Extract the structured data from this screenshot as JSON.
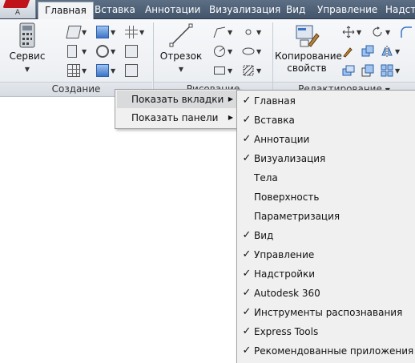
{
  "app_button": {
    "letter": "A"
  },
  "tabs": [
    {
      "label": "Главная",
      "active": true
    },
    {
      "label": "Вставка"
    },
    {
      "label": "Аннотации"
    },
    {
      "label": "Визуализация"
    },
    {
      "label": "Вид"
    },
    {
      "label": "Управление"
    },
    {
      "label": "Надстр"
    }
  ],
  "ribbon": {
    "service_label": "Сервис",
    "create_panel_title": "Создание",
    "draw_panel_title": "Рисование",
    "segment_label": "Отрезок",
    "copy_props_label_1": "Копирование",
    "copy_props_label_2": "свойств",
    "edit_panel_title": "Редактирование"
  },
  "context_menu": {
    "items": [
      {
        "label": "Показать вкладки",
        "highlighted": true
      },
      {
        "label": "Показать панели",
        "highlighted": false
      }
    ]
  },
  "submenu": {
    "items": [
      {
        "label": "Главная",
        "checked": true
      },
      {
        "label": "Вставка",
        "checked": true
      },
      {
        "label": "Аннотации",
        "checked": true
      },
      {
        "label": "Визуализация",
        "checked": true
      },
      {
        "label": "Тела",
        "checked": false
      },
      {
        "label": "Поверхность",
        "checked": false
      },
      {
        "label": "Параметризация",
        "checked": false
      },
      {
        "label": "Вид",
        "checked": true
      },
      {
        "label": "Управление",
        "checked": true
      },
      {
        "label": "Надстройки",
        "checked": true
      },
      {
        "label": "Autodesk 360",
        "checked": true
      },
      {
        "label": "Инструменты распознавания",
        "checked": true
      },
      {
        "label": "Express Tools",
        "checked": true
      },
      {
        "label": "Рекомендованные приложения",
        "checked": true
      }
    ]
  },
  "colors": {
    "tabbar": "#4b5d73",
    "menu_bg": "#f0f0f0",
    "menu_highlight": "#d9dadc",
    "logo_red": "#c0121a"
  }
}
